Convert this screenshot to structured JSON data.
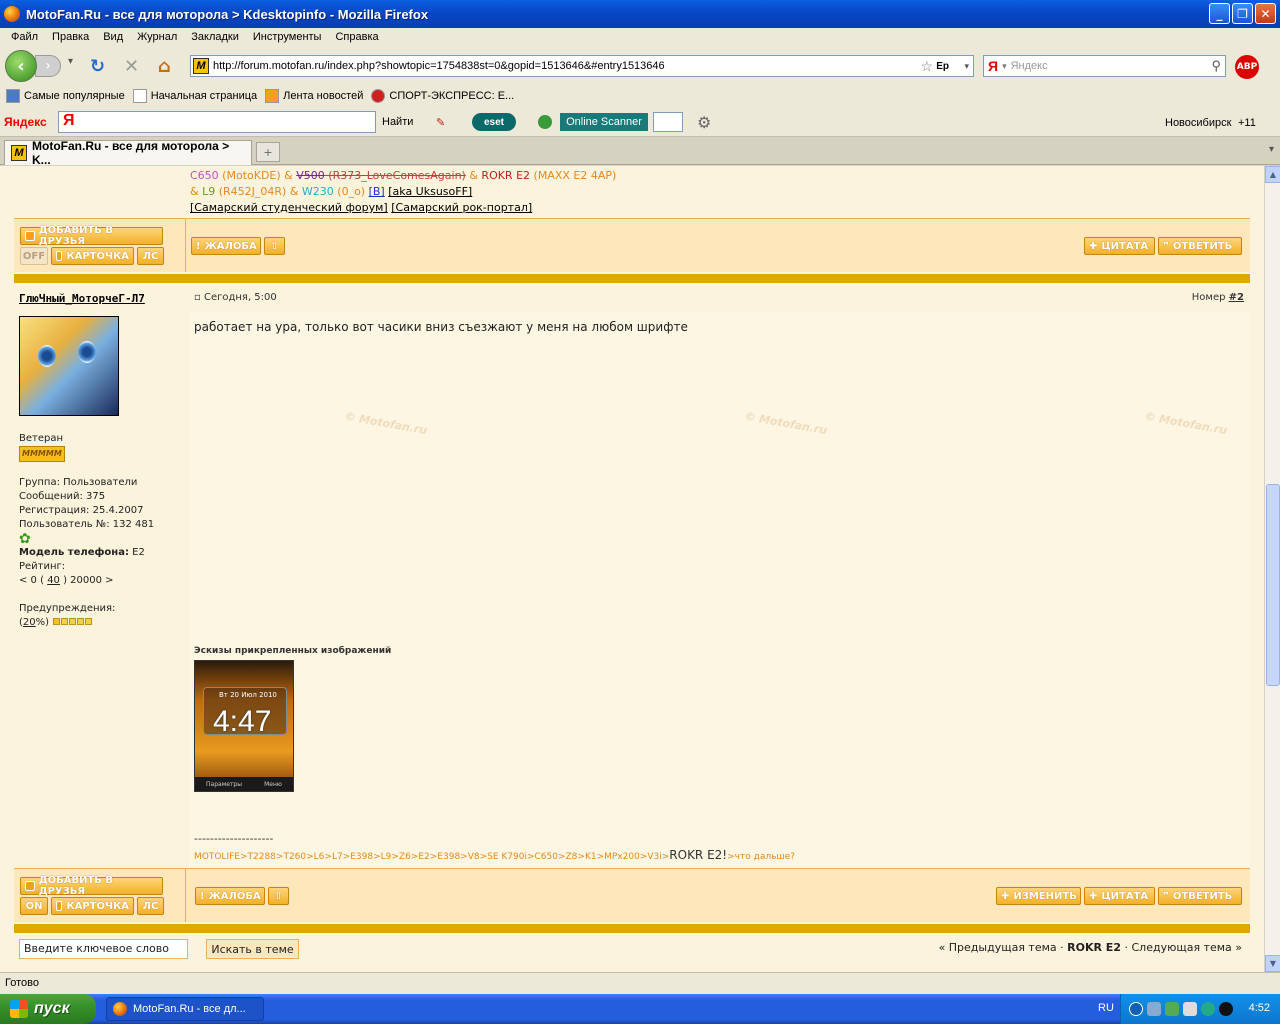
{
  "window": {
    "title": "MotoFan.Ru - все для моторола > Kdesktopinfo - Mozilla Firefox"
  },
  "menu": [
    "Файл",
    "Правка",
    "Вид",
    "Журнал",
    "Закладки",
    "Инструменты",
    "Справка"
  ],
  "nav": {
    "url": "http://forum.motofan.ru/index.php?showtopic=1754838st=0&gopid=1513646&#entry1513646",
    "search_placeholder": "Яндекс",
    "lang_indicator": "Ep",
    "abp": "ABP"
  },
  "bookmarks": [
    "Самые популярные",
    "Начальная страница",
    "Лента новостей",
    "СПОРТ-ЭКСПРЕСС: Е..."
  ],
  "yandex_bar": {
    "logo": "Яндекс",
    "find": "Найти",
    "eset": "eset",
    "online_scanner": "Online Scanner",
    "city": "Новосибирск",
    "temp": "+11"
  },
  "tab": {
    "title": "MotoFan.Ru - все для моторола > K...",
    "new_tab": "+"
  },
  "sig_prev": {
    "line1": {
      "a": "C650",
      "b": " (MotoKDE) & ",
      "c": "V500",
      "d": " (R373_LoveComesAgain)",
      "e": " & ",
      "f": "ROKR E2",
      "g": " (MAXX E2 4AP)"
    },
    "line2": {
      "a": "& ",
      "b": "L9",
      "c": " (R452J_04R) & ",
      "d": "W230",
      "e": " (0_o) ",
      "f": "[B]",
      "g": " ",
      "h": "[aka UksusoFF]"
    },
    "line3": {
      "a": "[Самарский студенческий форум]",
      "b": " ",
      "c": "[Самарский рок-портал]"
    }
  },
  "buttons": {
    "add_friend": "ДОБАВИТЬ В ДРУЗЬЯ",
    "off": "OFF",
    "on": "ON",
    "card": "КАРТОЧКА",
    "pm": "ЛС",
    "complain": "ЖАЛОБА",
    "quote": "ЦИТАТА",
    "reply": "ОТВЕТИТЬ",
    "edit": "ИЗМЕНИТЬ"
  },
  "post": {
    "author": "ГлюЧный_МоторчеГ-Л7",
    "date": "Сегодня, 5:00",
    "number_label": "Номер",
    "number": "#2",
    "text": "работает на ура, только вот часики вниз съезжают у меня на любом шрифте",
    "watermark": "© Motofan.ru",
    "attachments_title": "Эскизы прикрепленных изображений",
    "phone": {
      "date": "Вт 20 Июл 2010",
      "time": "4:47",
      "soft_left": "Параметры",
      "soft_right": "Меню"
    },
    "dashes": "--------------------",
    "sig": "MOTOLIFE>T2288>T260>L6>L7>E398>L9>Z6>E2>E398>V8>SE K790i>C650>Z8>K1>MPx200>V3i>",
    "sig_big": "ROKR E2!",
    "sig_tail": ">что дальше?"
  },
  "user": {
    "rank": "Ветеран",
    "rank_badge": "MMMMM",
    "group": "Группа: Пользователи",
    "messages": "Сообщений: 375",
    "registered": "Регистрация: 25.4.2007",
    "user_no": "Пользователь №: 132 481",
    "phone_label": "Модель телефона:",
    "phone_model": " E2",
    "rating_label": "Рейтинг:",
    "rating_pre": "< 0 ( ",
    "rating_val": "40",
    "rating_post": " ) 20000 >",
    "warnings_label": "Предупреждения:",
    "warn_pre": "(",
    "warn_val": "20",
    "warn_post": "%)"
  },
  "bottom": {
    "keyword_placeholder": "Введите ключевое слово",
    "search_topic": "Искать в теме",
    "prev": "« Предыдущая тема",
    "sep": " · ",
    "forum": "ROKR E2",
    "next": "Следующая тема »"
  },
  "status": {
    "text": "Готово"
  },
  "taskbar": {
    "start": "пуск",
    "item": "MotoFan.Ru - все дл...",
    "lang": "RU",
    "clock": "4:52"
  },
  "colors": {
    "accent": "#e2a800",
    "button": "#f3b02a",
    "content_bg": "#fcf3dc"
  }
}
